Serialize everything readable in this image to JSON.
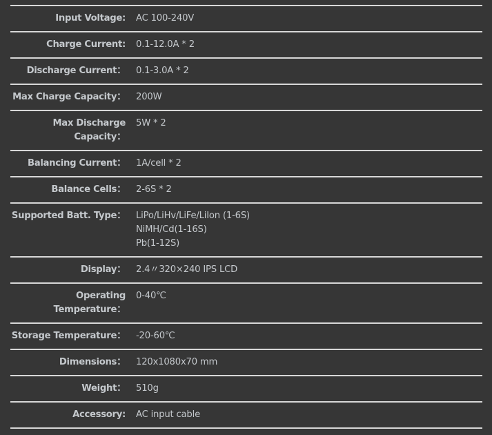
{
  "specs": [
    {
      "label": "Input Voltage:",
      "values": [
        "AC 100-240V"
      ]
    },
    {
      "label": "Charge Current:",
      "values": [
        "0.1-12.0A * 2"
      ]
    },
    {
      "label": "Discharge Current：",
      "values": [
        "0.1-3.0A * 2"
      ]
    },
    {
      "label": "Max Charge Capacity：",
      "values": [
        "200W"
      ]
    },
    {
      "label": "Max Discharge Capacity：",
      "values": [
        "5W * 2"
      ]
    },
    {
      "label": "Balancing Current：",
      "values": [
        "1A/cell * 2"
      ]
    },
    {
      "label": "Balance Cells：",
      "values": [
        "2-6S * 2"
      ]
    },
    {
      "label": "Supported Batt. Type：",
      "values": [
        "LiPo/LiHv/LiFe/LiIon (1-6S)",
        "NiMH/Cd(1-16S)",
        "Pb(1-12S)"
      ]
    },
    {
      "label": "Display：",
      "values": [
        "2.4〃320×240 IPS LCD"
      ]
    },
    {
      "label": "Operating Temperature：",
      "values": [
        "0-40℃"
      ]
    },
    {
      "label": "Storage Temperature：",
      "values": [
        "-20-60℃"
      ]
    },
    {
      "label": "Dimensions：",
      "values": [
        "120x1080x70 mm"
      ]
    },
    {
      "label": "Weight：",
      "values": [
        "510g"
      ]
    },
    {
      "label": "Accessory:",
      "values": [
        "AC input cable"
      ]
    }
  ]
}
